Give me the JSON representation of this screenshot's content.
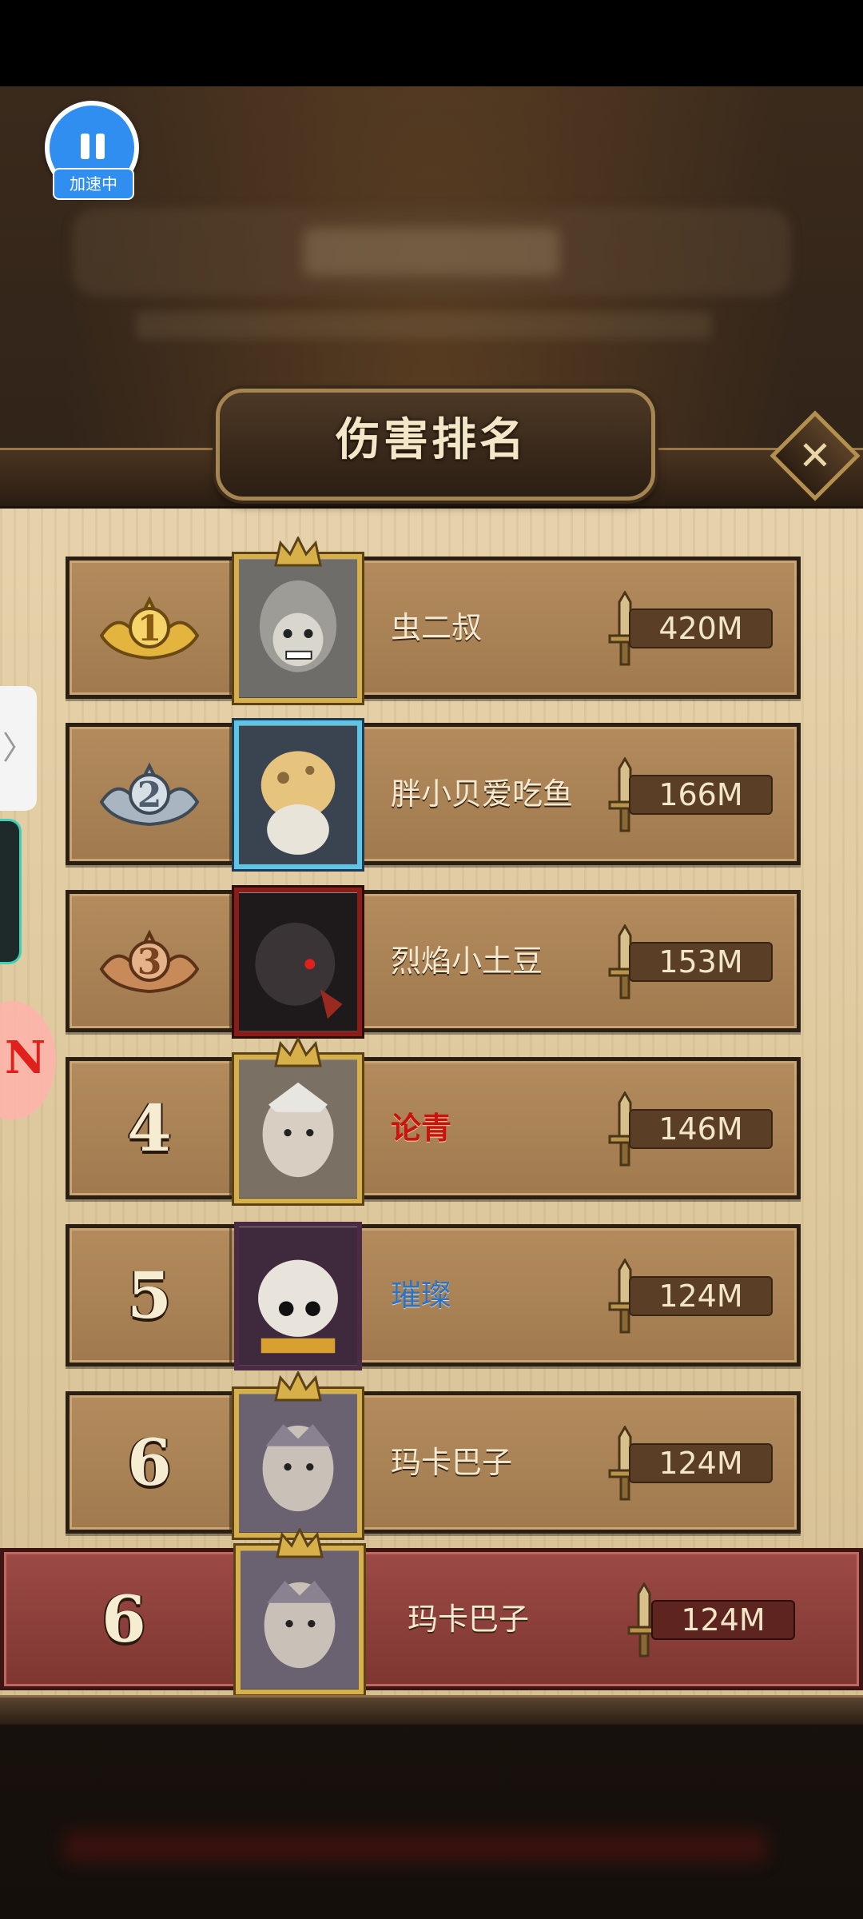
{
  "overlay": {
    "speed_label": "加速中"
  },
  "popup": {
    "title": "伤害排名",
    "close_symbol": "✕"
  },
  "rankings": [
    {
      "rank": "1",
      "name": "虫二叔",
      "damage": "420M"
    },
    {
      "rank": "2",
      "name": "胖小贝爱吃鱼",
      "damage": "166M"
    },
    {
      "rank": "3",
      "name": "烈焰小土豆",
      "damage": "153M"
    },
    {
      "rank": "4",
      "name": "论青",
      "damage": "146M"
    },
    {
      "rank": "5",
      "name": "璀璨",
      "damage": "124M"
    },
    {
      "rank": "6",
      "name": "玛卡巴子",
      "damage": "124M"
    }
  ],
  "my_rank": {
    "rank": "6",
    "name": "玛卡巴子",
    "damage": "124M"
  },
  "side_tab": {
    "chevron": "〉"
  },
  "colors": {
    "gold": "#d8b04a",
    "silver": "#b8c4d0",
    "bronze": "#c98a5a",
    "my_row": "#8b3c37"
  }
}
